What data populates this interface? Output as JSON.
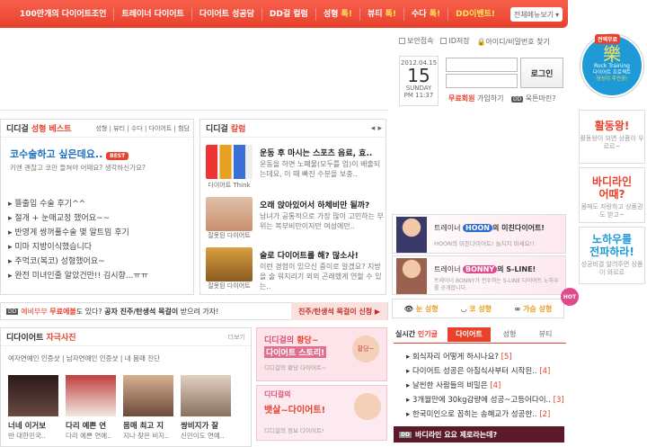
{
  "nav": {
    "items": [
      "100만개의 다이어트조언",
      "트레이너 다이어트",
      "다이어트 성공담",
      "DD걸 컬럼"
    ],
    "hot1": "성형",
    "hot2": "뷰티",
    "hot3": "수다",
    "hot_mark": "톡!",
    "event": "DD이벤트!",
    "all_menu": "전체메뉴보기"
  },
  "login": {
    "opt1": "보안접속",
    "opt2": "ID저장",
    "find": "아이디/비밀번호 찾기",
    "date_top": "2012.04.15",
    "day": "15",
    "weekday": "SUNDAY",
    "time": "PM 11:37",
    "btn": "로그인",
    "free": "무료회원",
    "join": "가입하기",
    "forgot": "욱튼마린?"
  },
  "right": {
    "rock_top": "전액무료",
    "rock_big": "樂",
    "rock_name": "Rock Training",
    "rock_sub": "다이어트 프로젝트",
    "rock_sub2": "당신이 주인공!",
    "box1_t": "활동왕!",
    "box1_s": "활동왕이 되면 상품이 우르르~",
    "box2_t": "바디라인",
    "box2_t2": "어때?",
    "box2_s": "몸매도 자랑하고 상품권도 받고~",
    "box3_t": "노하우를",
    "box3_t2": "전파하라!",
    "box3_s": "성공비결 알려주면 상품이 와르르"
  },
  "best": {
    "title1": "디디걸",
    "title2": "성형 베스트",
    "tabs": "성형 | 뷰티 | 수다 | 다이어트 | 험담",
    "headline": "코수술하고 싶은데요..",
    "best_tag": "BEST",
    "sub": "키엔 괜찮고 코만 들쳐야 어때요? 생각하신가요?",
    "items": [
      "뜰출입 수술 후기^^",
      "절개 + 눈매교정 했어요~~",
      "반영게 쌍꺼풀수술 몇 알트밈 후기",
      "미마 지방이식했습니다",
      "주먹코(복코) 성형했어요~",
      "완전 미녀인줄 알았건만!! 김시향...ㅠㅠ"
    ]
  },
  "column": {
    "title1": "디디걸",
    "title2": "칼럼",
    "cap1": "다이어트 Think",
    "cap2": "잘못된 다이어트",
    "cap3": "잘못된 다이어트",
    "a1_t": "운동 후 마시는 스포츠 음료, 효..",
    "a1_d": "운동을 하면 노폐물(모두를 업)이 배출되는데요, 이 때 빠진 수분을 보충..",
    "a2_t": "오래 앉아있어서 하체비만 될까?",
    "a2_d": "남녀가 공통적으로 가장 많이 고민하는 부위는 복부비만이지만 여성에만..",
    "a3_t": "술로 다이어트를 해? 많소사!",
    "a3_d": "이런 경험이 있으신 중이로 알겠요? 지방을 술 워지리기 외외 곤래했게 연할 수 있는.."
  },
  "promo": {
    "hoon_pre": "트레이너",
    "hoon_name": "HOON",
    "hoon_post": "의 미친다이어트!",
    "hoon_sub": "HOON의 미친다이어트! 놀치지 마세요!!",
    "bonny_pre": "트레이너",
    "bonny_name": "BONNY",
    "bonny_post": "의 S-LINE!",
    "bonny_sub": "트레이너 BONNY가 전수하는 S-LINE 다이어트 노하우를 공개합니다.",
    "s1": "눈 성형",
    "s2": "코 성형",
    "s3": "가슴 성형",
    "hot": "HOT"
  },
  "strip": {
    "dd": "DD",
    "pre": "예비부부",
    "free": "무료에볼",
    "mid": "도 있다?",
    "key": "공자 진주/탄생석 목걸이",
    "post": "받으려 가자!",
    "btn": "진주/탄생석 목걸이 신청 ▶"
  },
  "photo": {
    "title1": "디다이어트",
    "title2": "자극사진",
    "more": "더보기",
    "tabs": "여자연예인 인증샷 | 남자연예인 인증샷 | 내 몸매 진단",
    "captions": [
      "너네 이거보",
      "다리 예쁜 연",
      "몸매 최고 지",
      "쌍비지가 잘"
    ],
    "subs": [
      "반 대한민국..",
      "다리 예쁜 연예..",
      "지나 찾은 비지..",
      "신민이도 연예.."
    ]
  },
  "story": {
    "line1": "디디걸의",
    "hl1": "황당~",
    "line2": "다이어트 스토리!",
    "sub1": "디디걸의 황당 다이어트~",
    "bub": "황당~",
    "line3": "디디걸의",
    "hl2": "뱃살~",
    "line4": "다이어트!",
    "sub2": "디디걸의 정보 다이어트!"
  },
  "rank": {
    "t1": "실시간",
    "t1b": "인기글",
    "t2": "다이어트",
    "t3": "성형",
    "t4": "뷰티",
    "items": [
      {
        "t": "회식자리 어떻게 하시나요?",
        "n": "[5]"
      },
      {
        "t": "다이어트 성공은 아침식사부터 시작된..",
        "n": "[4]"
      },
      {
        "t": "날씬한 사람들의 비밀은",
        "n": "[4]"
      },
      {
        "t": "3개월만에 30kg감량에 성공~고등어다이..",
        "n": "[3]"
      },
      {
        "t": "한국미인으로 꼽히는 송혜교가 성공한..",
        "n": "[2]"
      }
    ],
    "bottom_dd": "DD",
    "bottom": "바디라인 요요 제로라는데?"
  }
}
